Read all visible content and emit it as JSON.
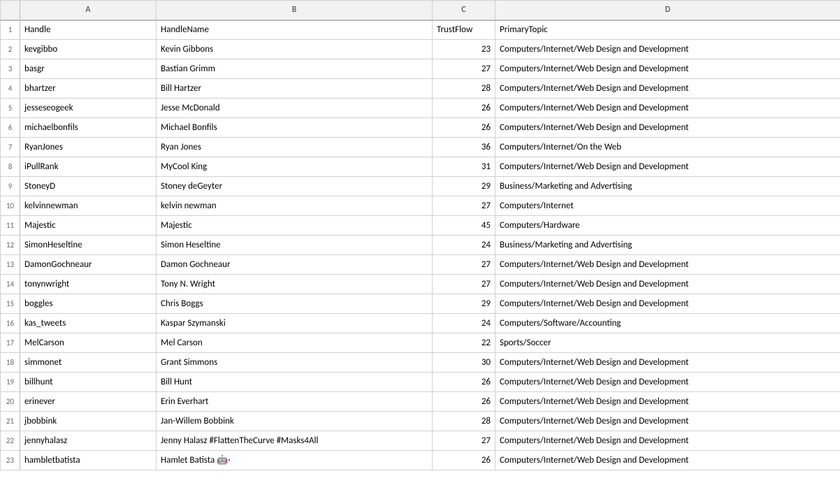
{
  "columns": {
    "headers": [
      "",
      "A",
      "B",
      "C",
      "D"
    ],
    "a_label": "A",
    "b_label": "B",
    "c_label": "C",
    "d_label": "D"
  },
  "rows": [
    {
      "num": "1",
      "a": "Handle",
      "b": "HandleName",
      "c": "TrustFlow",
      "d": "PrimaryTopic"
    },
    {
      "num": "2",
      "a": "kevgibbo",
      "b": "Kevin Gibbons",
      "c": "23",
      "d": "Computers/Internet/Web Design and Development"
    },
    {
      "num": "3",
      "a": "basgr",
      "b": "Bastian Grimm",
      "c": "27",
      "d": "Computers/Internet/Web Design and Development"
    },
    {
      "num": "4",
      "a": "bhartzer",
      "b": "Bill Hartzer",
      "c": "28",
      "d": "Computers/Internet/Web Design and Development"
    },
    {
      "num": "5",
      "a": "jesseseogeek",
      "b": "Jesse McDonald",
      "c": "26",
      "d": "Computers/Internet/Web Design and Development"
    },
    {
      "num": "6",
      "a": "michaelbonfils",
      "b": "Michael Bonfils",
      "c": "26",
      "d": "Computers/Internet/Web Design and Development"
    },
    {
      "num": "7",
      "a": "RyanJones",
      "b": "Ryan Jones",
      "c": "36",
      "d": "Computers/Internet/On the Web"
    },
    {
      "num": "8",
      "a": "iPullRank",
      "b": "MyCool King",
      "c": "31",
      "d": "Computers/Internet/Web Design and Development"
    },
    {
      "num": "9",
      "a": "StoneyD",
      "b": "Stoney deGeyter",
      "c": "29",
      "d": "Business/Marketing and Advertising"
    },
    {
      "num": "10",
      "a": "kelvinnewman",
      "b": "kelvin newman",
      "c": "27",
      "d": "Computers/Internet"
    },
    {
      "num": "11",
      "a": "Majestic",
      "b": "Majestic",
      "c": "45",
      "d": "Computers/Hardware"
    },
    {
      "num": "12",
      "a": "SimonHeseltine",
      "b": "Simon Heseltine",
      "c": "24",
      "d": "Business/Marketing and Advertising"
    },
    {
      "num": "13",
      "a": "DamonGochneaur",
      "b": "Damon Gochneaur",
      "c": "27",
      "d": "Computers/Internet/Web Design and Development"
    },
    {
      "num": "14",
      "a": "tonynwright",
      "b": "Tony N. Wright",
      "c": "27",
      "d": "Computers/Internet/Web Design and Development"
    },
    {
      "num": "15",
      "a": "boggles",
      "b": "Chris Boggs",
      "c": "29",
      "d": "Computers/Internet/Web Design and Development"
    },
    {
      "num": "16",
      "a": "kas_tweets",
      "b": "Kaspar Szymanski",
      "c": "24",
      "d": "Computers/Software/Accounting"
    },
    {
      "num": "17",
      "a": "MelCarson",
      "b": "Mel Carson",
      "c": "22",
      "d": "Sports/Soccer"
    },
    {
      "num": "18",
      "a": "simmonet",
      "b": "Grant Simmons",
      "c": "30",
      "d": "Computers/Internet/Web Design and Development"
    },
    {
      "num": "19",
      "a": "billhunt",
      "b": "Bill Hunt",
      "c": "26",
      "d": "Computers/Internet/Web Design and Development"
    },
    {
      "num": "20",
      "a": "erinever",
      "b": "Erin Everhart",
      "c": "26",
      "d": "Computers/Internet/Web Design and Development"
    },
    {
      "num": "21",
      "a": "jbobbink",
      "b": "Jan-Willem Bobbink",
      "c": "28",
      "d": "Computers/Internet/Web Design and Development"
    },
    {
      "num": "22",
      "a": "jennyhalasz",
      "b": "Jenny Halasz #FlattenTheCurve #Masks4All",
      "c": "27",
      "d": "Computers/Internet/Web Design and Development"
    },
    {
      "num": "23",
      "a": "hambletbatista",
      "b": "Hamlet Batista 🤖·",
      "c": "26",
      "d": "Computers/Internet/Web Design and Development"
    }
  ]
}
